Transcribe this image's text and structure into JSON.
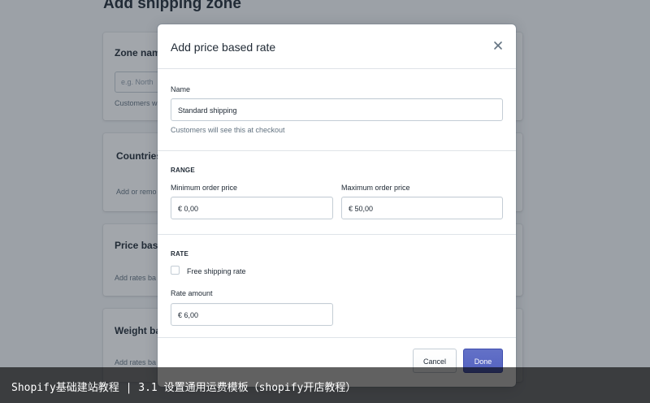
{
  "background": {
    "page_title": "Add shipping zone",
    "cards": [
      {
        "title": "Zone name",
        "input_placeholder": "e.g. North",
        "text": "Customers w"
      },
      {
        "title": "Countries",
        "text": "Add or remo"
      },
      {
        "title": "Price based",
        "text": "Add rates ba"
      },
      {
        "title": "Weight bas",
        "text": "Add rates ba"
      }
    ]
  },
  "modal": {
    "title": "Add price based rate",
    "close_icon": "close-icon",
    "name": {
      "label": "Name",
      "value": "Standard shipping",
      "help": "Customers will see this at checkout"
    },
    "range": {
      "heading": "RANGE",
      "min_label": "Minimum order price",
      "min_value": "€ 0,00",
      "max_label": "Maximum order price",
      "max_value": "€ 50,00"
    },
    "rate": {
      "heading": "RATE",
      "free_shipping_label": "Free shipping rate",
      "free_shipping_checked": false,
      "amount_label": "Rate amount",
      "amount_value": "€ 6,00"
    },
    "footer": {
      "cancel_label": "Cancel",
      "done_label": "Done"
    }
  },
  "caption": "Shopify基础建站教程 | 3.1 设置通用运费模板（shopify开店教程）",
  "colors": {
    "primary": "#5c6ac4",
    "overlay": "#212b36"
  }
}
